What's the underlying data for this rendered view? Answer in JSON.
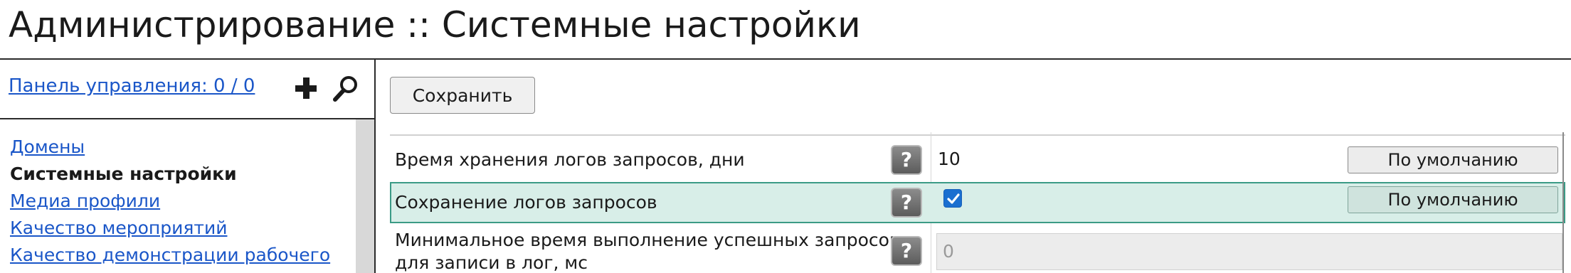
{
  "page": {
    "title": "Администрирование :: Системные настройки"
  },
  "sidebar": {
    "panel_link": "Панель управления: 0 / 0",
    "add_icon": "plus-icon",
    "search_icon": "search-icon",
    "items": [
      {
        "label": "Домены",
        "active": false
      },
      {
        "label": "Системные настройки",
        "active": true
      },
      {
        "label": "Медиа профили",
        "active": false
      },
      {
        "label": "Качество мероприятий",
        "active": false
      },
      {
        "label": "Качество демонстрации рабочего",
        "active": false
      }
    ]
  },
  "toolbar": {
    "save_label": "Сохранить"
  },
  "settings": {
    "rows": [
      {
        "label": "Время хранения логов запросов, дни",
        "help_label": "?",
        "value": "10",
        "default_label": "По умолчанию"
      },
      {
        "label": "Сохранение логов запросов",
        "help_label": "?",
        "checked": true,
        "default_label": "По умолчанию"
      },
      {
        "label_line1": "Минимальное время выполнение успешных запросов",
        "label_line2": "для записи в лог, мс",
        "help_label": "?",
        "value": "0"
      }
    ]
  },
  "colors": {
    "link": "#1a56c8",
    "highlight_row": "#d8eee8",
    "highlight_border": "#3b9b86",
    "checkbox": "#1a6fd0"
  }
}
